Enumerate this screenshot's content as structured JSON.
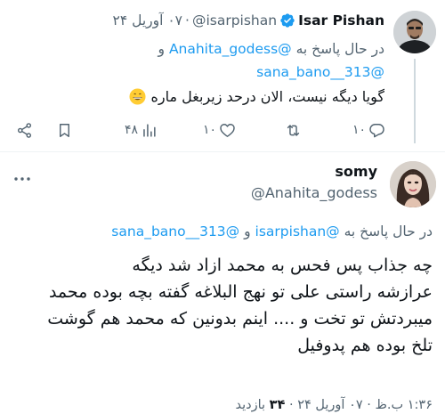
{
  "reply_tweet": {
    "author_name": "Isar Pishan",
    "author_handle": "@isarpishan",
    "separator": "·",
    "date": "۰۷ آوریل ۲۴",
    "reply_prefix": "در حال پاسخ به",
    "reply_mentions": [
      "@Anahita_godess",
      "@sana_bano__313"
    ],
    "reply_joiner": "و",
    "text": "گویا دیگه نیست، الان درحد زیربغل ماره",
    "emoji": "grinning-face-emoji",
    "actions": {
      "reply_count": "۱۰",
      "retweet_count": "",
      "like_count": "۱۰",
      "views_count": "۴۸"
    }
  },
  "main_tweet": {
    "author_name": "somy",
    "author_handle": "@Anahita_godess",
    "reply_prefix": "در حال پاسخ به",
    "reply_mentions": [
      "@isarpishan",
      "@sana_bano__313"
    ],
    "reply_joiner": "و",
    "text_lines": [
      "چه جذاب پس فحس به محمد ازاد شد دیگه",
      "عرازشه راستی علی تو نهج البلاغه گفته بچه بوده محمد",
      "میبردتش تو تخت و .... اینم بدونین که محمد هم گوشت",
      "تلخ بوده هم پدوفیل"
    ],
    "meta_time": "۱:۳۶ ب.ظ",
    "meta_separator": "·",
    "meta_date": "۰۷ آوریل ۲۴",
    "views_count": "۳۴",
    "views_label": "بازدید"
  },
  "icons": {
    "verified": "verified-badge-icon",
    "reply": "reply-icon",
    "retweet": "retweet-icon",
    "like": "heart-icon",
    "views": "views-icon",
    "bookmark": "bookmark-icon",
    "share": "share-icon",
    "more": "more-icon"
  },
  "colors": {
    "accent": "#1d9bf0",
    "text": "#0f1419",
    "muted": "#536471",
    "divider": "#eff3f4"
  }
}
